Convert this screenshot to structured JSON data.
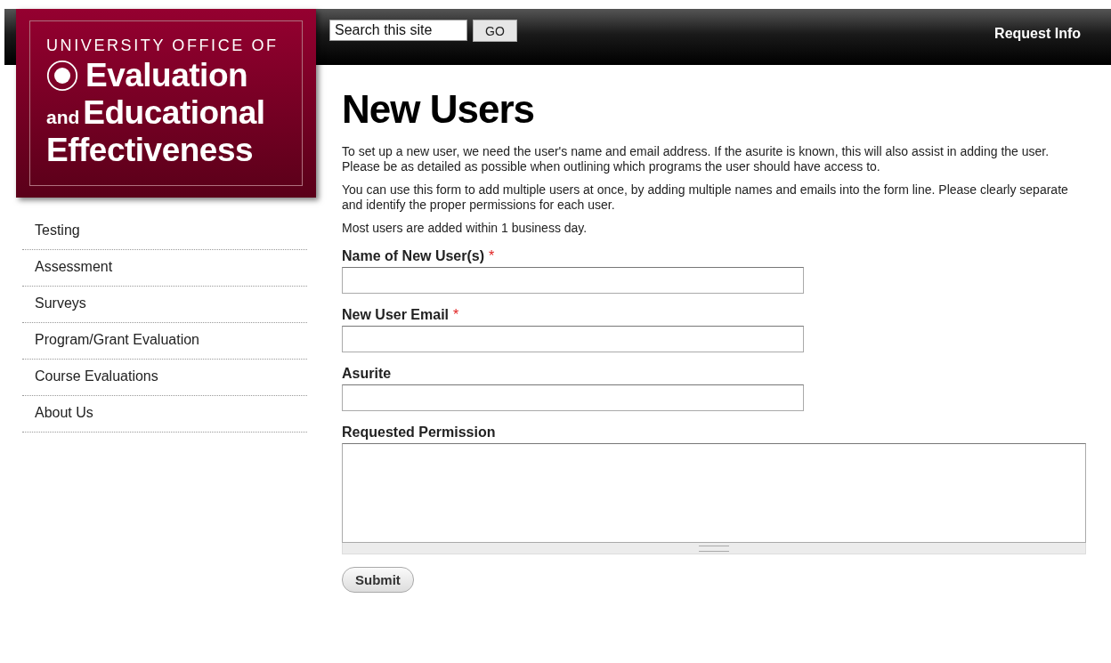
{
  "logo": {
    "overline": "UNIVERSITY OFFICE OF",
    "line_1": "Evaluation",
    "connector": "and",
    "line_2": "Educational",
    "line_3": "Effectiveness"
  },
  "header": {
    "search": {
      "value": "Search this site"
    },
    "search_button": "GO",
    "link": "Request Info"
  },
  "sidebar": {
    "items": [
      {
        "label": "Testing"
      },
      {
        "label": "Assessment"
      },
      {
        "label": "Surveys"
      },
      {
        "label": "Program/Grant Evaluation"
      },
      {
        "label": "Course Evaluations"
      },
      {
        "label": "About Us"
      }
    ]
  },
  "page": {
    "title": "New Users",
    "paragraphs": [
      "To set up a new user, we need the user's name and email address. If the asurite is known, this will also assist in adding the user. Please be as detailed as possible when outlining which programs the user should have access to.",
      "You can use this form to add multiple users at once, by adding multiple names and emails into the form line. Please clearly separate and identify the proper permissions for each user.",
      "Most users are added within 1 business day."
    ]
  },
  "form": {
    "fields": [
      {
        "label": "Name of New User(s)",
        "required": true,
        "required_mark": "*",
        "kind": "text"
      },
      {
        "label": "New User Email",
        "required": true,
        "required_mark": "*",
        "kind": "text"
      },
      {
        "label": "Asurite",
        "required": false,
        "kind": "text"
      },
      {
        "label": "Requested Permission",
        "required": false,
        "kind": "textarea"
      }
    ],
    "submit": "Submit"
  }
}
